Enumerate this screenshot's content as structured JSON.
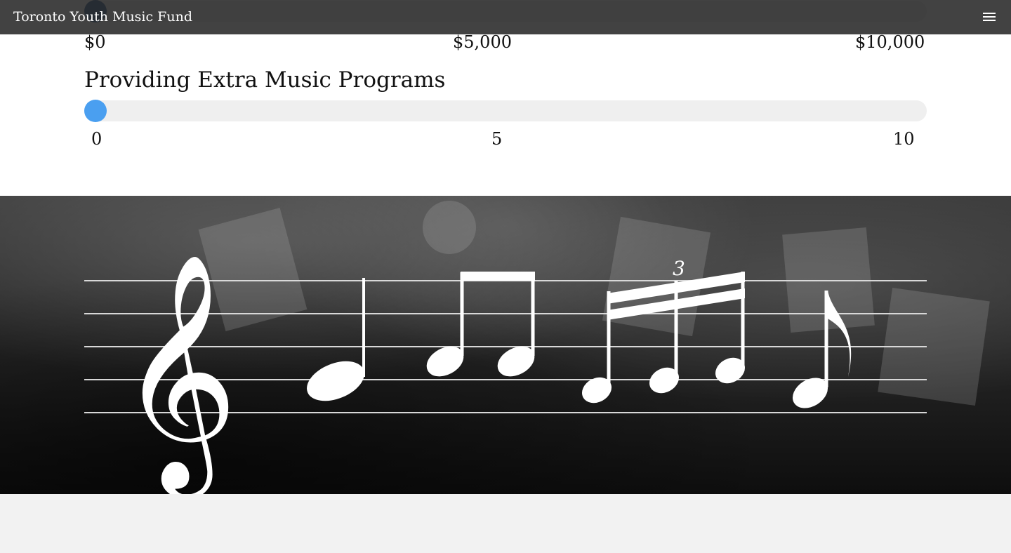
{
  "header": {
    "brand": "Toronto Youth Music Fund",
    "menu_icon": "hamburger-menu-icon"
  },
  "donation_slider": {
    "min_label": "$0",
    "mid_label": "$5,000",
    "max_label": "$10,000"
  },
  "programs_slider": {
    "title": "Providing Extra Music Programs",
    "min_label": "0",
    "mid_label": "5",
    "max_label": "10",
    "value": 0
  },
  "banner": {
    "triplet_label": "3",
    "icons": [
      "treble-clef-icon",
      "quarter-note-icon",
      "beamed-eighth-notes-icon",
      "triplet-sixteenth-notes-icon",
      "eighth-note-icon"
    ]
  },
  "colors": {
    "accent": "#4a9ff0",
    "topbar": "#282828",
    "track": "#efefef",
    "footer": "#f2f2f2"
  }
}
